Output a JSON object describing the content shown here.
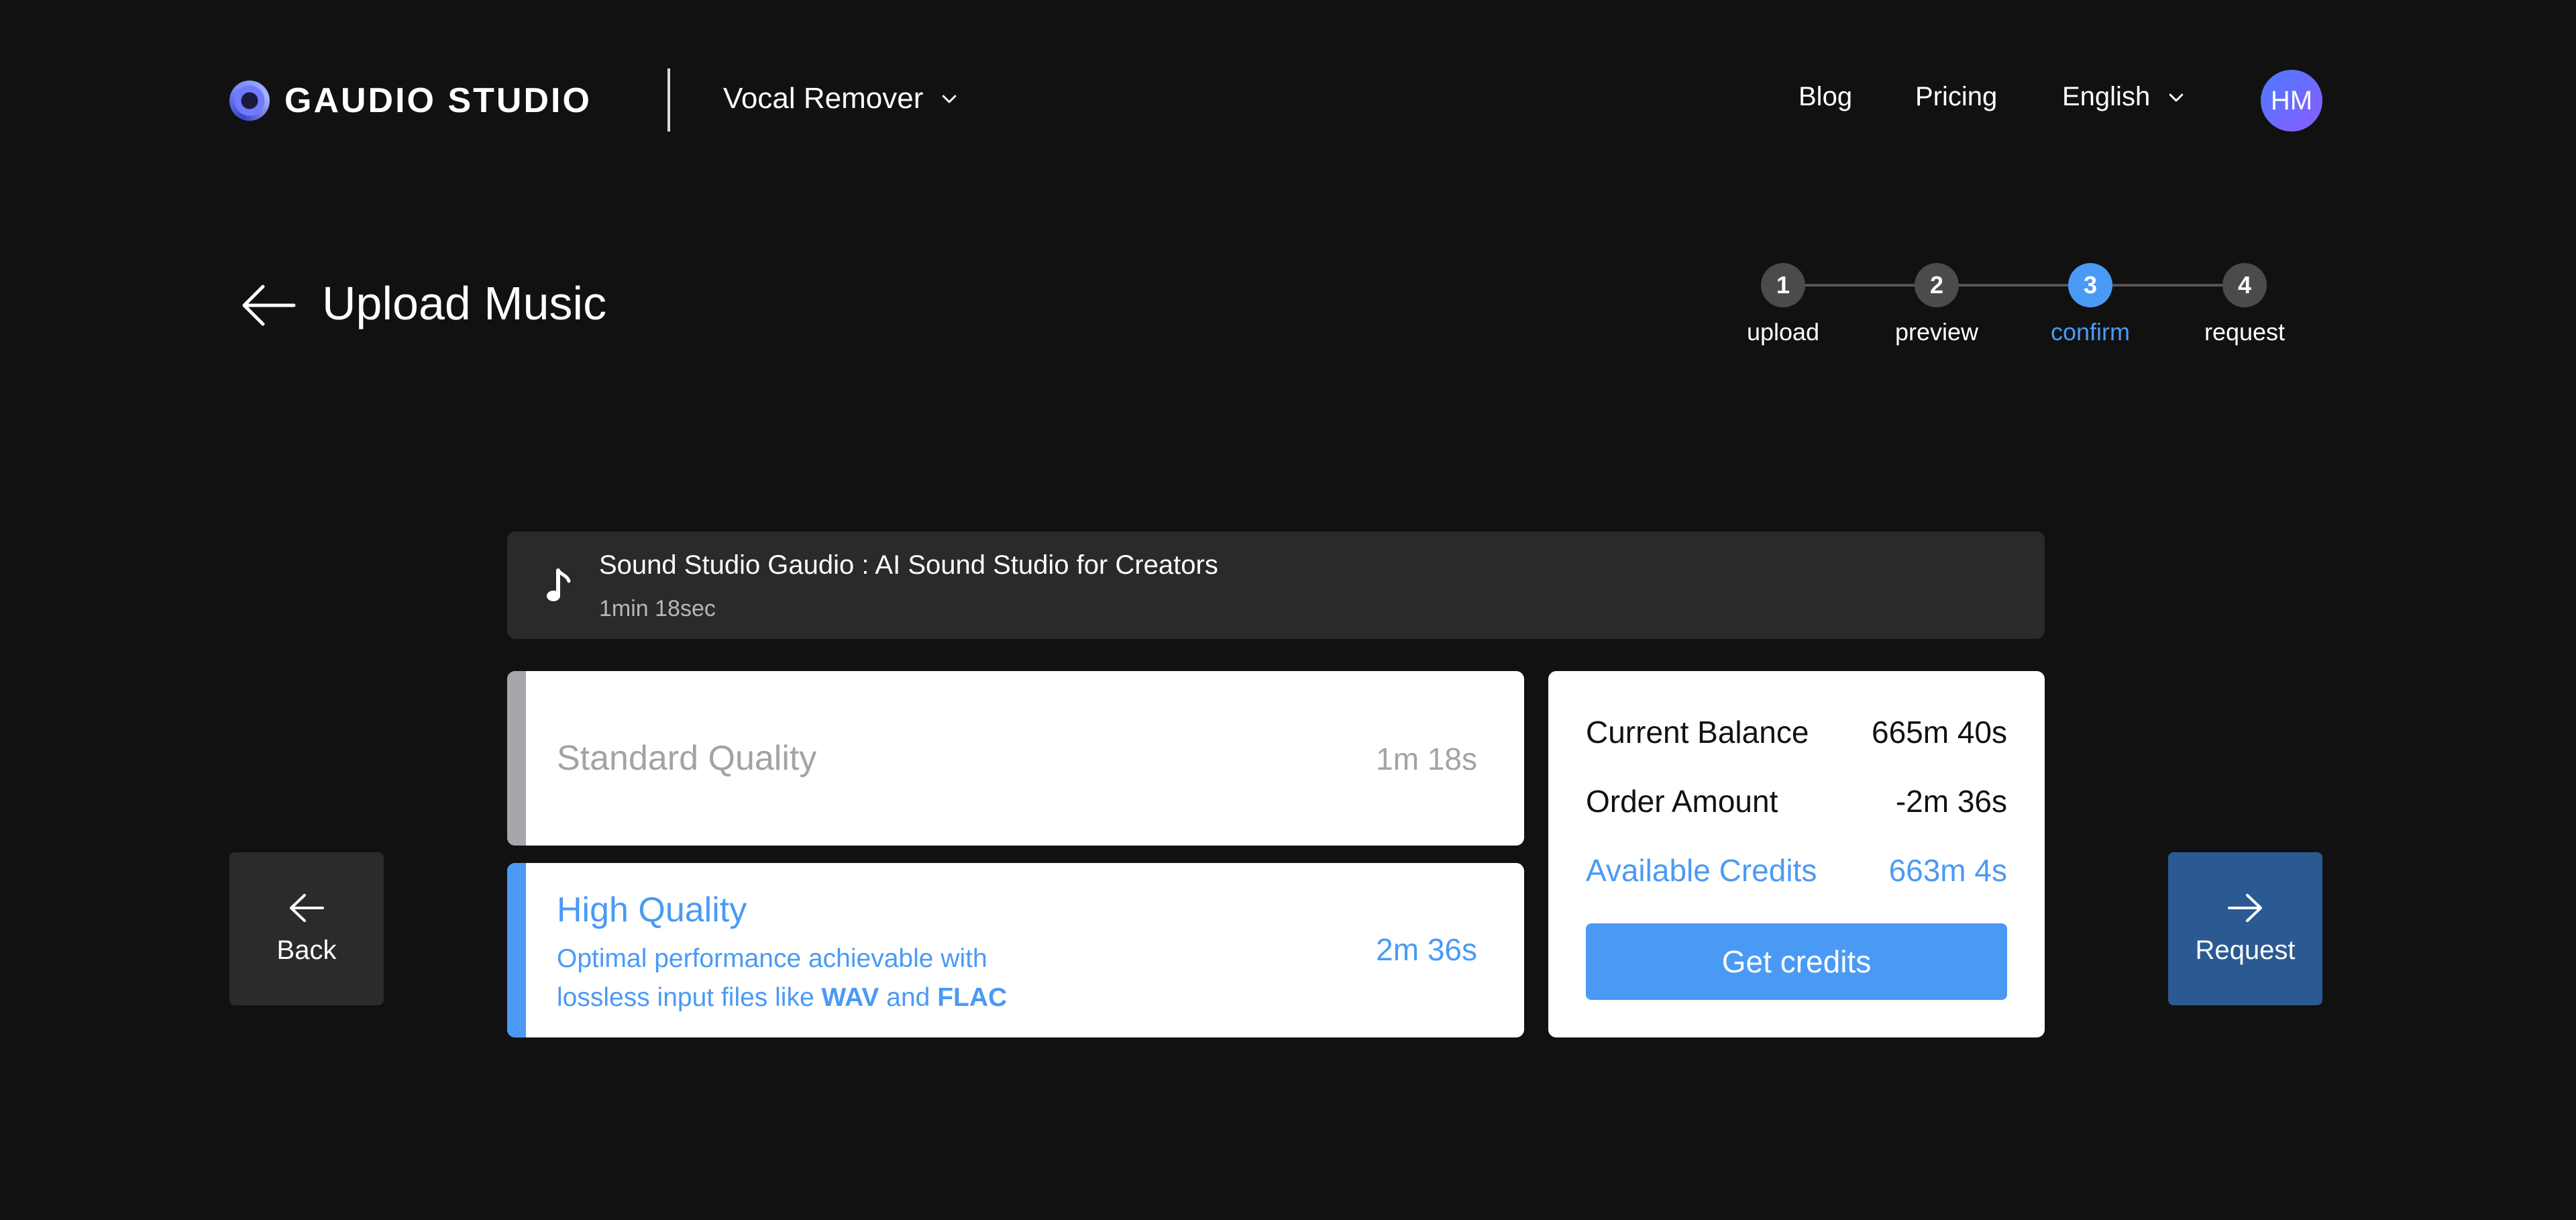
{
  "header": {
    "brand": "GAUDIO STUDIO",
    "product": "Vocal Remover",
    "nav": {
      "blog": "Blog",
      "pricing": "Pricing",
      "language": "English"
    },
    "avatar_initials": "HM"
  },
  "page": {
    "title": "Upload Music"
  },
  "stepper": {
    "current_step": 3,
    "steps": [
      {
        "number": "1",
        "label": "upload"
      },
      {
        "number": "2",
        "label": "preview"
      },
      {
        "number": "3",
        "label": "confirm"
      },
      {
        "number": "4",
        "label": "request"
      }
    ]
  },
  "track": {
    "title": "Sound Studio Gaudio : AI Sound Studio for Creators",
    "duration": "1min 18sec"
  },
  "quality": {
    "standard": {
      "title": "Standard Quality",
      "time": "1m 18s"
    },
    "high": {
      "title": "High Quality",
      "desc_line1": "Optimal performance achievable with",
      "desc_line2_prefix": "lossless input files like ",
      "format1": "WAV",
      "desc_and": " and ",
      "format2": "FLAC",
      "time": "2m 36s"
    }
  },
  "balance": {
    "current_label": "Current Balance",
    "current_value": "665m 40s",
    "order_label": "Order Amount",
    "order_value": "-2m 36s",
    "available_label": "Available Credits",
    "available_value": "663m 4s",
    "get_credits": "Get credits"
  },
  "actions": {
    "back": "Back",
    "request": "Request"
  },
  "colors": {
    "background": "#111111",
    "accent": "#4a9af5",
    "request_button": "#2b5a92"
  }
}
